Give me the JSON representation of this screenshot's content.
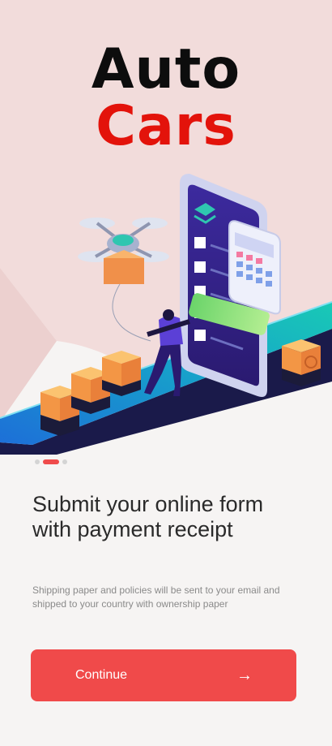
{
  "logo": {
    "line1": "Auto",
    "line2": "Cars"
  },
  "onboarding": {
    "total_pages": 3,
    "active_page": 2,
    "title": "Submit your online form with payment receipt",
    "subtitle": "Shipping paper and policies will be sent to your email and shipped to your country with ownership paper"
  },
  "continue_button": {
    "label": "Continue",
    "icon": "arrow-right-icon"
  },
  "colors": {
    "background": "#f6f4f3",
    "hero_pink": "#f2dcdb",
    "accent_red": "#f04a4a",
    "logo_black": "#0d0d0d",
    "logo_red": "#e3130b",
    "phone_purple": "#3a1e8c"
  }
}
